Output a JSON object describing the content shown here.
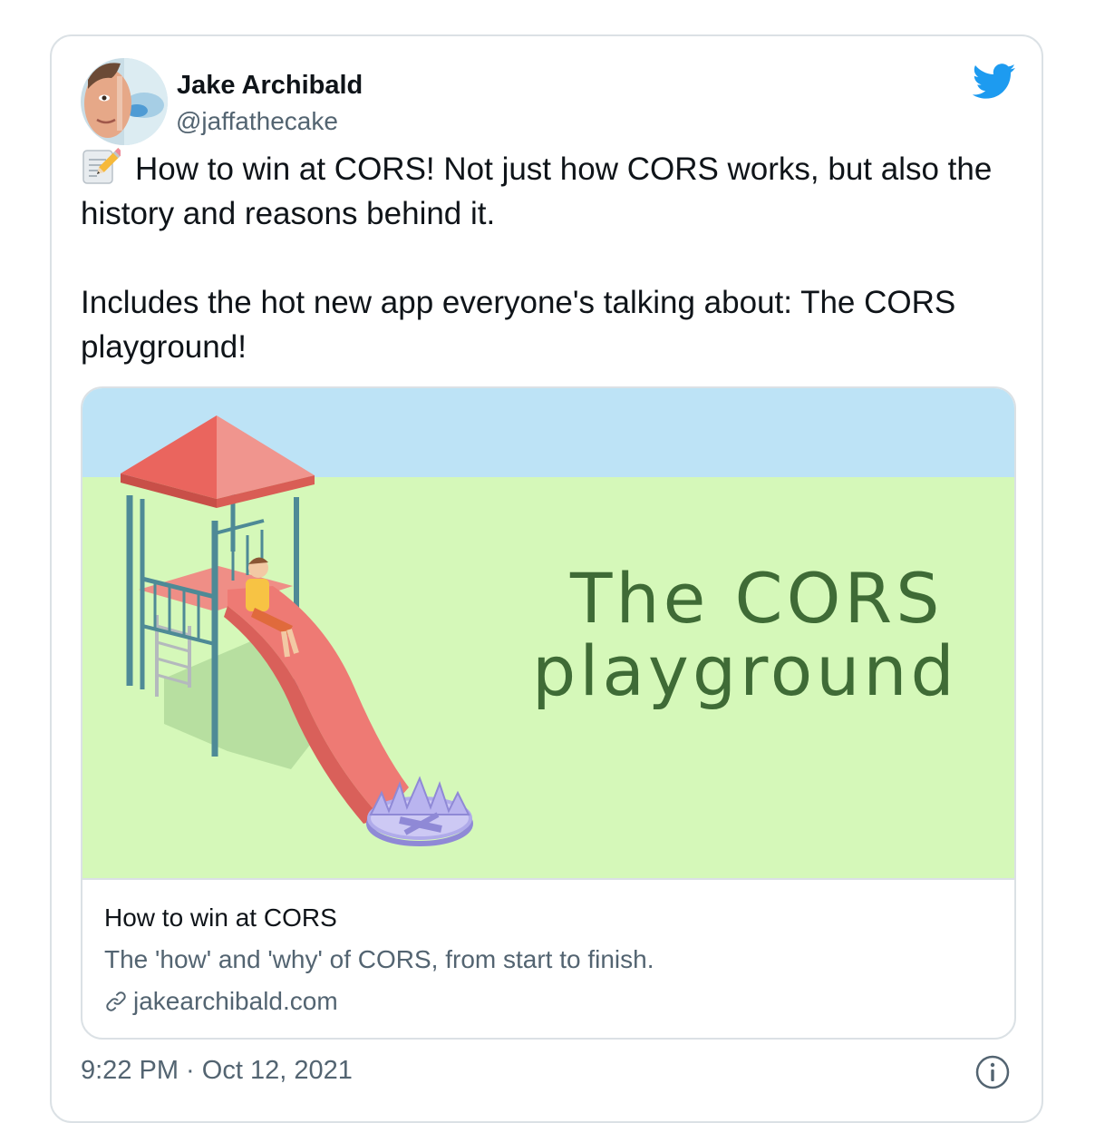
{
  "author": {
    "display_name": "Jake Archibald",
    "handle": "@jaffathecake",
    "avatar_icon": "user-avatar"
  },
  "tweet": {
    "emoji_icon": "memo-icon",
    "paragraph1": "How to win at CORS! Not just how CORS works, but also the history and reasons behind it.",
    "paragraph2": "Includes the hot new app everyone's talking about: The CORS playground!"
  },
  "link_card": {
    "image_title_line1": "The CORS",
    "image_title_line2": "playground",
    "title": "How to win at CORS",
    "description": "The 'how' and 'why' of CORS, from start to finish.",
    "domain": "jakearchibald.com",
    "link_icon": "link-icon"
  },
  "footer": {
    "timestamp": "9:22 PM · Oct 12, 2021",
    "info_icon": "info-icon"
  },
  "colors": {
    "twitter_blue": "#1d9bf0",
    "text_primary": "#0f1419",
    "text_secondary": "#536471",
    "card_border": "#dbe1e5",
    "sky": "#bde3f6",
    "grass": "#d5f8b9",
    "slide": "#ee7a74"
  }
}
